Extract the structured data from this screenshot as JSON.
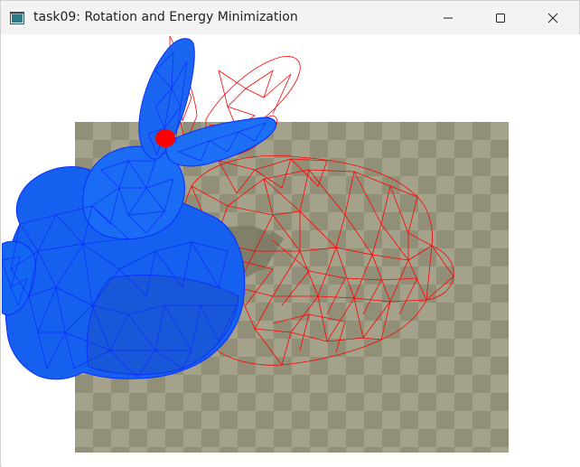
{
  "window": {
    "title": "task09: Rotation and Energy Minimization"
  },
  "controls": {
    "minimize_icon": "minimize-icon",
    "maximize_icon": "maximize-icon",
    "close_icon": "close-icon"
  },
  "scene": {
    "floor_color_light": "#a4a28a",
    "floor_color_dark": "#918f78",
    "solid_mesh_color": "#1060f0",
    "solid_edge_color": "#0a2dff",
    "wire_mesh_color": "#ff0000",
    "handle_color": "#ff0000"
  }
}
